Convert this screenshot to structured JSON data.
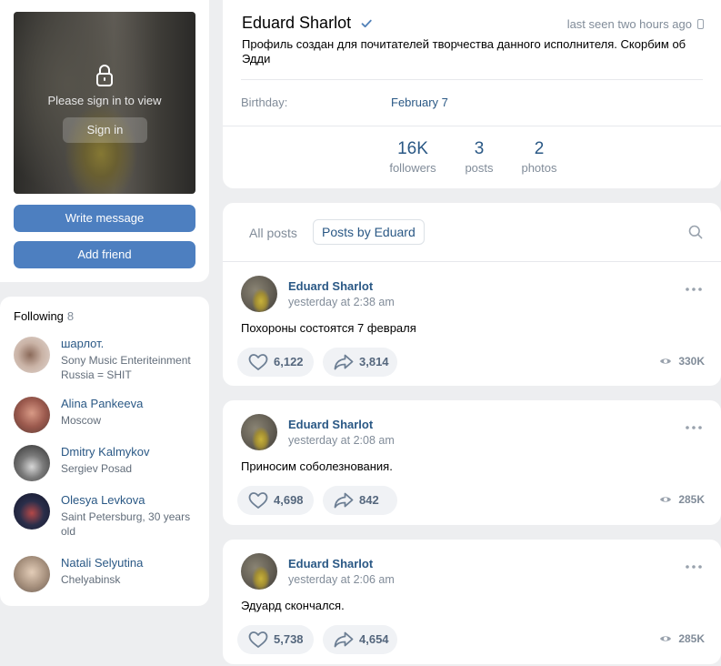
{
  "sidebar": {
    "photo": {
      "prompt": "Please sign in to view",
      "signin_label": "Sign in"
    },
    "write_message_label": "Write message",
    "add_friend_label": "Add friend",
    "following": {
      "title": "Following",
      "count": "8",
      "items": [
        {
          "name": "шарлот.",
          "sub": "Sony Music Enteriteinment Russia = SHIT"
        },
        {
          "name": "Alina Pankeeva",
          "sub": "Moscow"
        },
        {
          "name": "Dmitry Kalmykov",
          "sub": "Sergiev Posad"
        },
        {
          "name": "Olesya Levkova",
          "sub": "Saint Petersburg, 30 years old"
        },
        {
          "name": "Natali Selyutina",
          "sub": "Chelyabinsk"
        }
      ]
    }
  },
  "profile": {
    "name": "Eduard Sharlot",
    "last_seen": "last seen two hours ago",
    "status": "Профиль создан для почитателей творчества данного исполнителя. Скорбим об Эдди",
    "birthday_label": "Birthday:",
    "birthday_value": "February 7",
    "counters": [
      {
        "value": "16K",
        "label": "followers"
      },
      {
        "value": "3",
        "label": "posts"
      },
      {
        "value": "2",
        "label": "photos"
      }
    ]
  },
  "wall": {
    "tab_all": "All posts",
    "tab_by": "Posts by Eduard",
    "posts": [
      {
        "author": "Eduard Sharlot",
        "time": "yesterday at 2:38 am",
        "text": "Похороны состоятся 7 февраля",
        "likes": "6,122",
        "shares": "3,814",
        "views": "330K"
      },
      {
        "author": "Eduard Sharlot",
        "time": "yesterday at 2:08 am",
        "text": "Приносим соболезнования.",
        "likes": "4,698",
        "shares": "842",
        "views": "285K"
      },
      {
        "author": "Eduard Sharlot",
        "time": "yesterday at 2:06 am",
        "text": "Эдуард скончался.",
        "likes": "5,738",
        "shares": "4,654",
        "views": "285K"
      }
    ]
  },
  "colors": {
    "accent": "#4d7fc0",
    "link": "#2a5885",
    "muted": "#818c99",
    "background": "#edeef0"
  }
}
